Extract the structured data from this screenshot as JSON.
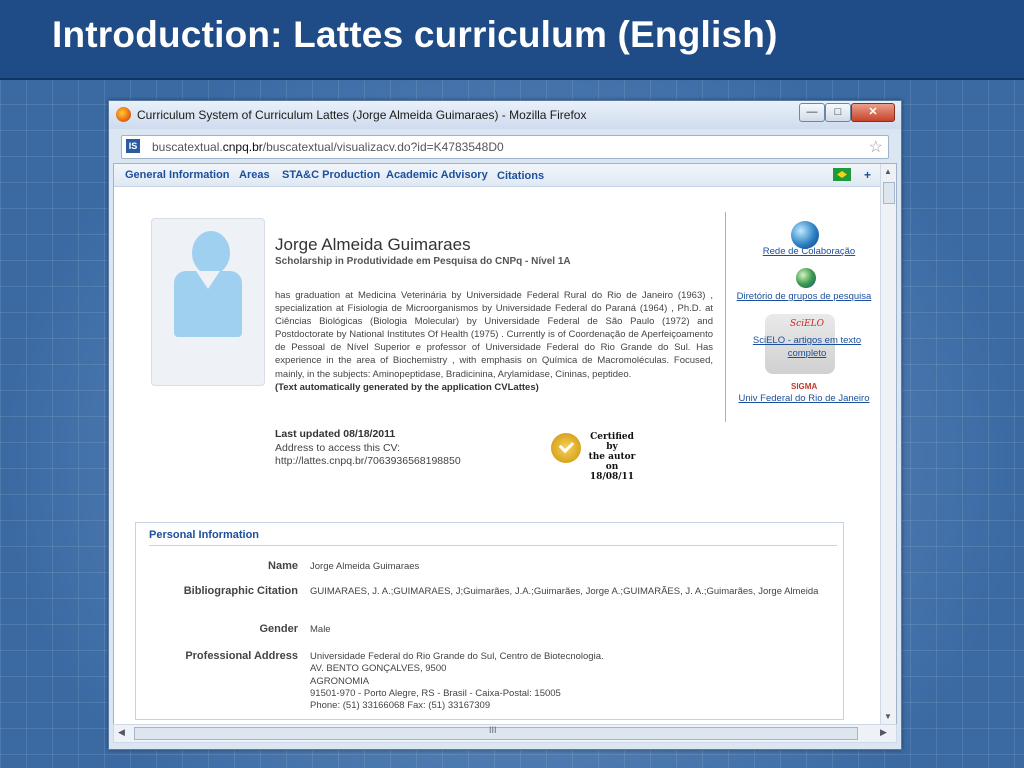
{
  "slide": {
    "title": "Introduction: Lattes curriculum (English)"
  },
  "browser": {
    "window_title": "Curriculum System of Curriculum Lattes (Jorge Almeida Guimaraes) - Mozilla Firefox",
    "url_prefix": "buscatextual.",
    "url_domain": "cnpq.br",
    "url_path": "/buscatextual/visualizacv.do?id=K4783548D0",
    "buttons": {
      "minimize": "—",
      "maximize": "□",
      "close": "✕"
    }
  },
  "nav": {
    "items": [
      "General Information",
      "Areas",
      "STA&C Production",
      "Academic Advisory",
      "Citations"
    ],
    "plus": "+"
  },
  "profile": {
    "name": "Jorge Almeida Guimaraes",
    "subtitle": "Scholarship in Produtividade em Pesquisa do CNPq - Nível 1A",
    "bio": "has graduation at Medicina Veterinária by Universidade Federal Rural do Rio de Janeiro (1963) , specialization at Fisiologia de Microorganismos by Universidade Federal do Paraná (1964) , Ph.D. at Ciências Biológicas (Biologia Molecular) by Universidade Federal de São Paulo (1972) and Postdoctorate by National Institutes Of Health (1975) . Currently is of Coordenação de Aperfeiçoamento de Pessoal de Nível Superior e professor of Universidade Federal do Rio Grande do Sul. Has experience in the area of Biochemistry , with emphasis on Química de Macromoléculas. Focused, mainly, in the subjects: Aminopeptidase, Bradicinina, Arylamidase, Cininas, peptideo.",
    "bio_note": "(Text automatically generated by the application CVLattes)",
    "last_updated": "Last updated 08/18/2011",
    "address_label": "Address to access this CV:",
    "address_url": "http://lattes.cnpq.br/7063936568198850",
    "certified_lines": [
      "Certified by",
      "the autor on",
      "18/08/11"
    ]
  },
  "side_links": {
    "collab": "Rede de Colaboração",
    "groups": "Diretório de grupos de pesquisa",
    "scielo_logo": "SciELO",
    "scielo": "SciELO - artigos em texto completo",
    "sigma": "SIGMA",
    "univ": "Univ Federal do Rio de Janeiro"
  },
  "personal_info": {
    "title": "Personal Information",
    "rows": [
      {
        "label": "Name",
        "value": "Jorge Almeida Guimaraes"
      },
      {
        "label": "Bibliographic Citation",
        "value": "GUIMARAES, J. A.;GUIMARAES, J;Guimarães, J.A.;Guimarães, Jorge A.;GUIMARÃES, J. A.;Guimarães, Jorge Almeida"
      },
      {
        "label": "Gender",
        "value": "Male"
      },
      {
        "label": "Professional Address",
        "lines": [
          "Universidade Federal do Rio Grande do Sul, Centro de Biotecnologia.",
          "AV. BENTO GONÇALVES, 9500",
          "AGRONOMIA",
          "91501-970 - Porto Alegre, RS - Brasil - Caixa-Postal: 15005",
          "Phone: (51) 33166068 Fax: (51) 33167309"
        ]
      }
    ]
  },
  "scrollbar": {
    "grip": "III"
  },
  "colors": {
    "slide_title_bar": "#1f4c86",
    "link": "#1c4f9c"
  }
}
